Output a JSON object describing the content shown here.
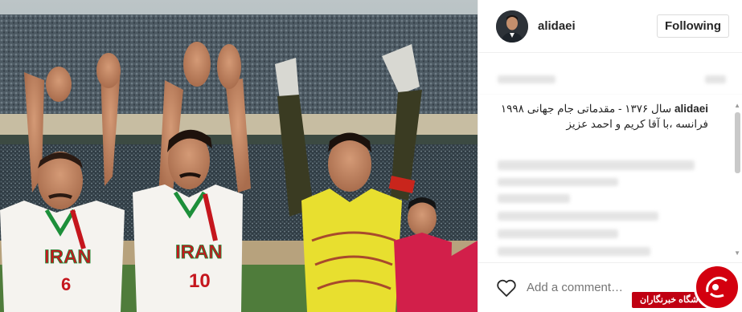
{
  "post": {
    "username": "alidaei",
    "follow_label": "Following",
    "caption_user": "alidaei",
    "caption_text": "سال ۱۳۷۶ - مقدماتی جام جهانی ۱۹۹۸ فرانسه ،با آقا کریم و احمد عزیز",
    "comment_placeholder": "Add a comment…"
  },
  "photo": {
    "jersey_text": "IRAN",
    "jersey_numbers": [
      "6",
      "10"
    ]
  },
  "watermark": {
    "text": "باشگاه خبرنگاران"
  },
  "colors": {
    "accent": "#c00012",
    "text": "#262626",
    "border": "#efefef"
  },
  "icons": {
    "heart": "heart-icon",
    "scroll_up": "chevron-up-icon",
    "scroll_down": "chevron-down-icon"
  }
}
